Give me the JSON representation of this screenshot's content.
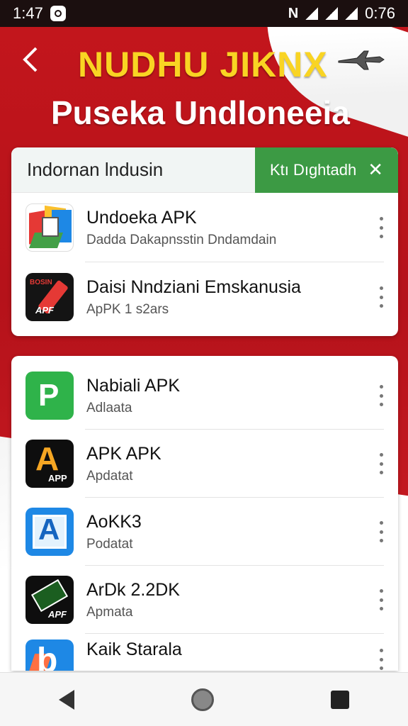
{
  "status_bar": {
    "time": "1:47",
    "nfc": "N",
    "battery_time": "0:76"
  },
  "header": {
    "title": "NUDHU JIKNX",
    "subtitle": "Puseka Undloneeia"
  },
  "card1": {
    "heading": "Indornan lndusin",
    "chip_label": "Ktı Dıghtadh",
    "items": [
      {
        "title": "Undoeka APK",
        "subtitle": "Dadda Dakapnsstin Dndamdain",
        "icon": "multicolor-doc-icon"
      },
      {
        "title": "Daisi Nndziani Emskanusia",
        "subtitle": "ApPK 1 s2ars",
        "icon": "red-pen-app-icon"
      }
    ]
  },
  "card2": {
    "items": [
      {
        "title": "Nabiali APK",
        "subtitle": "Adlaata",
        "icon": "green-p-app-icon"
      },
      {
        "title": "APK APK",
        "subtitle": "Apdatat",
        "icon": "orange-a-app-icon"
      },
      {
        "title": "AoKK3",
        "subtitle": "Podatat",
        "icon": "blue-a-app-icon"
      },
      {
        "title": "ArDk 2.2DK",
        "subtitle": "Apmata",
        "icon": "dark-flag-app-icon"
      },
      {
        "title": "Kaik Starala",
        "subtitle": "",
        "icon": "blue-b-app-icon"
      }
    ]
  },
  "icon_labels": {
    "dark_label": "BOSIN",
    "apf": "APF",
    "app": "APP",
    "p_letter": "P",
    "a_letter": "A",
    "b_letter": "b"
  },
  "colors": {
    "banner_red": "#c4161c",
    "title_yellow": "#f9d423",
    "chip_green": "#3c9a44"
  }
}
